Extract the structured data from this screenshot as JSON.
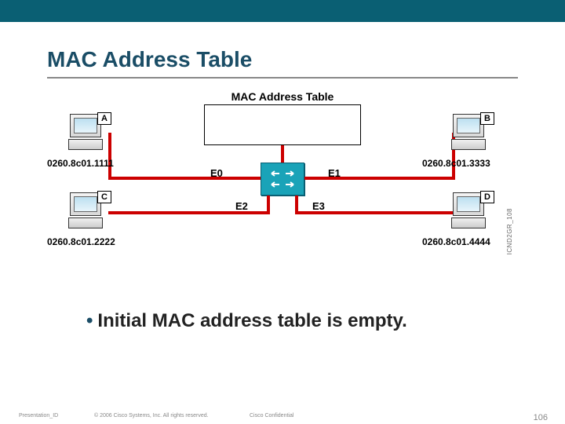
{
  "title": "MAC Address Table",
  "mat_label": "MAC Address Table",
  "ports": {
    "e0": "E0",
    "e1": "E1",
    "e2": "E2",
    "e3": "E3"
  },
  "hosts": {
    "A": {
      "tag": "A",
      "mac": "0260.8c01.1111"
    },
    "B": {
      "tag": "B",
      "mac": "0260.8c01.3333"
    },
    "C": {
      "tag": "C",
      "mac": "0260.8c01.2222"
    },
    "D": {
      "tag": "D",
      "mac": "0260.8c01.4444"
    }
  },
  "side_code": "ICND2GR_108",
  "bullet": "Initial MAC address table is empty.",
  "footer": {
    "pid": "Presentation_ID",
    "copy": "© 2006 Cisco Systems, Inc. All rights reserved.",
    "conf": "Cisco Confidential",
    "page": "106"
  }
}
